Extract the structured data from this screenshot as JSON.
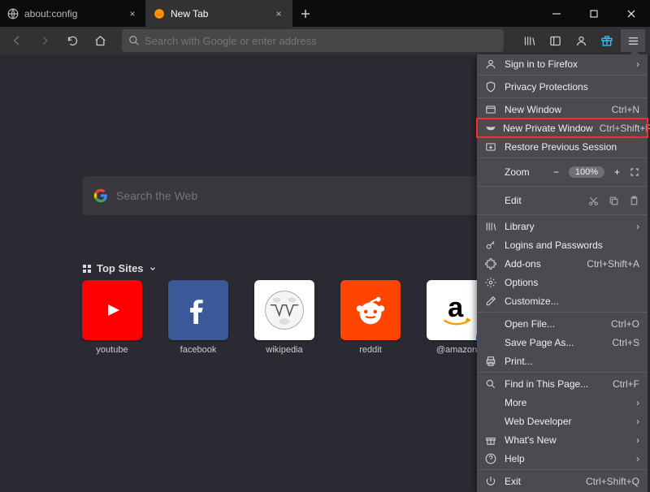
{
  "tabs": [
    {
      "title": "about:config",
      "active": false,
      "icon": "globe"
    },
    {
      "title": "New Tab",
      "active": true,
      "icon": "firefox"
    }
  ],
  "urlbar": {
    "placeholder": "Search with Google or enter address"
  },
  "search": {
    "placeholder": "Search the Web"
  },
  "topsites": {
    "header": "Top Sites",
    "tiles": [
      {
        "id": "youtube",
        "label": "youtube"
      },
      {
        "id": "facebook",
        "label": "facebook"
      },
      {
        "id": "wikipedia",
        "label": "wikipedia"
      },
      {
        "id": "reddit",
        "label": "reddit"
      },
      {
        "id": "amazon",
        "label": "@amazon"
      }
    ]
  },
  "menu": {
    "signin": "Sign in to Firefox",
    "privacy": "Privacy Protections",
    "new_window": {
      "label": "New Window",
      "shortcut": "Ctrl+N"
    },
    "new_private": {
      "label": "New Private Window",
      "shortcut": "Ctrl+Shift+P"
    },
    "restore": "Restore Previous Session",
    "zoom": {
      "label": "Zoom",
      "value": "100%"
    },
    "edit": {
      "label": "Edit"
    },
    "library": "Library",
    "logins": "Logins and Passwords",
    "addons": {
      "label": "Add-ons",
      "shortcut": "Ctrl+Shift+A"
    },
    "options": "Options",
    "customize": "Customize...",
    "open_file": {
      "label": "Open File...",
      "shortcut": "Ctrl+O"
    },
    "save_as": {
      "label": "Save Page As...",
      "shortcut": "Ctrl+S"
    },
    "print": "Print...",
    "find": {
      "label": "Find in This Page...",
      "shortcut": "Ctrl+F"
    },
    "more": "More",
    "webdev": "Web Developer",
    "whatsnew": "What's New",
    "help": "Help",
    "exit": {
      "label": "Exit",
      "shortcut": "Ctrl+Shift+Q"
    }
  }
}
